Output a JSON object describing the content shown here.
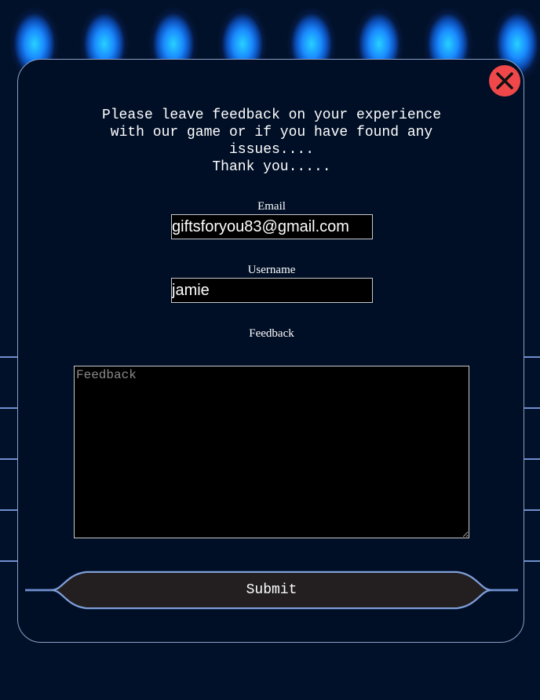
{
  "intro": {
    "text": "Please leave feedback on your experience\nwith our game or if you have found any\nissues....\nThank you....."
  },
  "form": {
    "email_label": "Email",
    "email_value": "giftsforyou83@gmail.com",
    "username_label": "Username",
    "username_value": "jamie",
    "feedback_label": "Feedback",
    "feedback_placeholder": "Feedback",
    "submit_label": "Submit"
  },
  "icons": {
    "close": "close-icon"
  },
  "colors": {
    "background": "#02112a",
    "modal_bg": "#000f26",
    "close_button": "#f0484a",
    "submit_bg": "#231f20",
    "border_accent": "#6f8fd0",
    "spotlight": "#1a8bff"
  }
}
